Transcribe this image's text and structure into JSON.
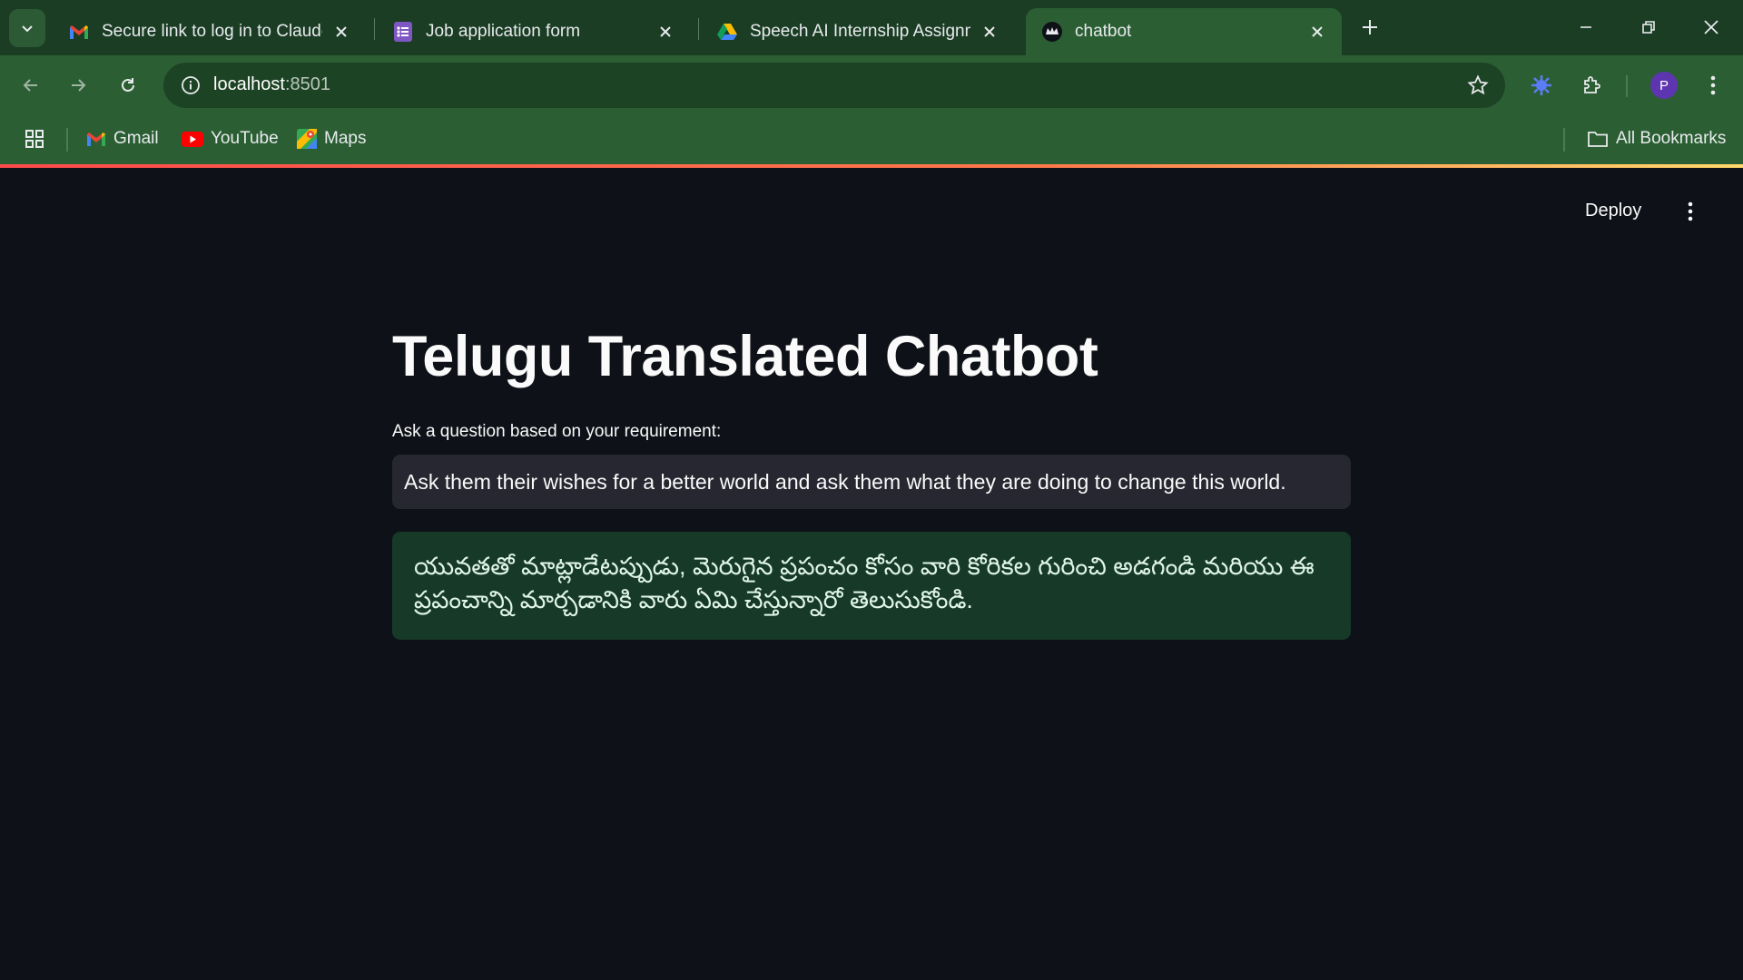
{
  "browser": {
    "tabs": [
      {
        "title": "Secure link to log in to Claude.ai",
        "favicon": "gmail-icon"
      },
      {
        "title": "Job application form",
        "favicon": "forms-icon"
      },
      {
        "title": "Speech AI Internship Assignment",
        "favicon": "drive-icon"
      },
      {
        "title": "chatbot",
        "favicon": "streamlit-icon",
        "active": true
      }
    ],
    "url_host": "localhost",
    "url_port": ":8501",
    "profile_initial": "P",
    "bookmarks": [
      {
        "label": "Gmail",
        "icon": "gmail-icon"
      },
      {
        "label": "YouTube",
        "icon": "youtube-icon"
      },
      {
        "label": "Maps",
        "icon": "maps-icon"
      }
    ],
    "all_bookmarks_label": "All Bookmarks"
  },
  "header": {
    "deploy_label": "Deploy"
  },
  "main": {
    "title": "Telugu Translated Chatbot",
    "input_label": "Ask a question based on your requirement:",
    "input_value": "Ask them their wishes for a better world and ask them what they are doing to change this world.",
    "translation": "యువతతో మాట్లాడేటప్పుడు, మెరుగైన ప్రపంచం కోసం వారి కోరికల గురించి అడగండి మరియు ఈ ప్రపంచాన్ని మార్చడానికి వారు ఏమి చేస్తున్నారో తెలుసుకోండి."
  },
  "colors": {
    "app_background": "#0e1117",
    "tab_strip": "#1a3d24",
    "toolbar": "#2b5f33",
    "input_background": "#262730",
    "success_background": "#173928"
  }
}
